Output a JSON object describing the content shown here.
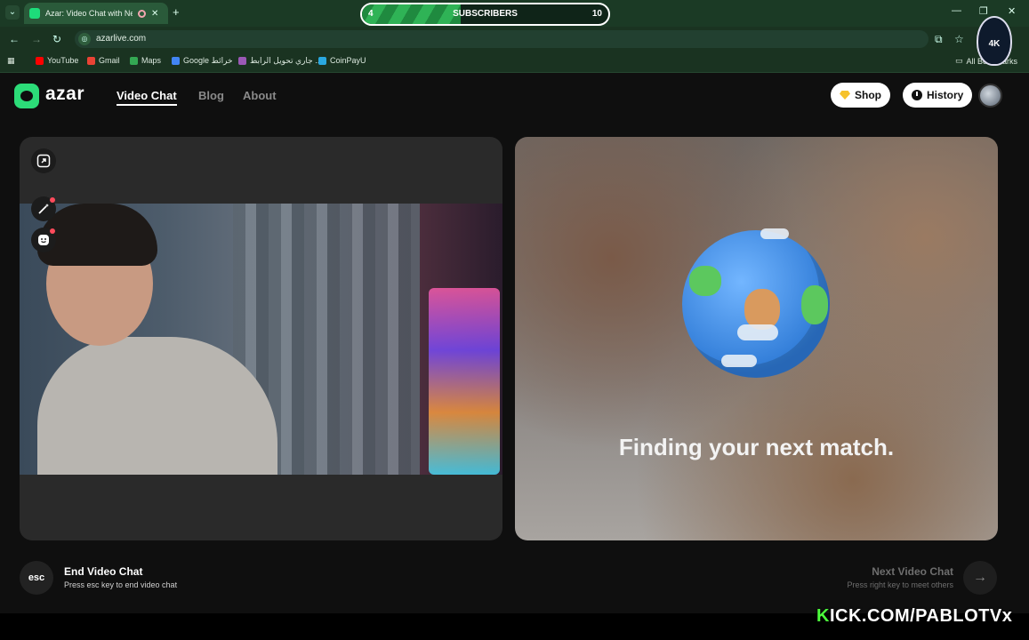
{
  "browser": {
    "tab_title": "Azar: Video Chat with New",
    "tab_close": "✕",
    "new_tab": "+",
    "menu_glyph": "⌄",
    "minimize": "—",
    "restore": "❐",
    "close": "✕",
    "url": "azarlive.com",
    "back": "←",
    "forward": "→",
    "reload": "↻",
    "bookmarks": [
      {
        "label": "YouTube",
        "color": "#ff0000",
        "icon": "youtube-icon"
      },
      {
        "label": "Gmail",
        "color": "#ea4335",
        "icon": "gmail-icon"
      },
      {
        "label": "Maps",
        "color": "#34a853",
        "icon": "maps-icon"
      },
      {
        "label": "Google خرائط",
        "color": "#4285f4",
        "icon": "google-icon"
      },
      {
        "label": "جاري تحويل الرابط ..",
        "color": "#9b59b6",
        "icon": "link-icon"
      },
      {
        "label": "CoinPayU",
        "color": "#2aa8e0",
        "icon": "coinpayu-icon"
      }
    ],
    "all_bookmarks": "All Bookmarks"
  },
  "overlay": {
    "subscribers_label": "SUBSCRIBERS",
    "subscribers_current": "4",
    "subscribers_goal": "10",
    "subscribers_progress": 0.4,
    "badge_text": "4K",
    "kick_prefix": "K",
    "kick_rest": "ICK.COM/PABLOTVx"
  },
  "site": {
    "logo": "azar",
    "nav": [
      {
        "label": "Video Chat",
        "active": true
      },
      {
        "label": "Blog",
        "active": false
      },
      {
        "label": "About",
        "active": false
      }
    ],
    "shop_label": "Shop",
    "history_label": "History",
    "finding_text": "Finding your next match.",
    "end_key": "esc",
    "end_title": "End Video Chat",
    "end_sub": "Press esc key to end video chat",
    "next_title": "Next Video Chat",
    "next_sub": "Press right key to meet others",
    "next_arrow": "→"
  },
  "colors": {
    "brand": "#2cdc78",
    "browser_chrome": "#1b3a25",
    "background": "#0f0f0f",
    "panel": "#2a2a2a"
  }
}
